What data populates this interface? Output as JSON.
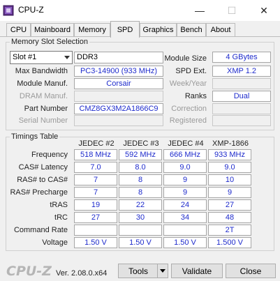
{
  "window": {
    "title": "CPU-Z",
    "minimize": "—",
    "maximize": "☐",
    "close": "✕"
  },
  "tabs": [
    {
      "label": "CPU"
    },
    {
      "label": "Mainboard"
    },
    {
      "label": "Memory"
    },
    {
      "label": "SPD"
    },
    {
      "label": "Graphics"
    },
    {
      "label": "Bench"
    },
    {
      "label": "About"
    }
  ],
  "active_tab": "SPD",
  "slot": {
    "group_title": "Memory Slot Selection",
    "selected": "Slot #1",
    "type": "DDR3",
    "module_size_label": "Module Size",
    "module_size": "4 GBytes",
    "max_bandwidth_label": "Max Bandwidth",
    "max_bandwidth": "PC3-14900 (933 MHz)",
    "spd_ext_label": "SPD Ext.",
    "spd_ext": "XMP 1.2",
    "module_manuf_label": "Module Manuf.",
    "module_manuf": "Corsair",
    "week_year_label": "Week/Year",
    "week_year": "",
    "dram_manuf_label": "DRAM Manuf.",
    "dram_manuf": "",
    "ranks_label": "Ranks",
    "ranks": "Dual",
    "part_number_label": "Part Number",
    "part_number": "CMZ8GX3M2A1866C9",
    "correction_label": "Correction",
    "correction": "",
    "serial_number_label": "Serial Number",
    "serial_number": "",
    "registered_label": "Registered",
    "registered": ""
  },
  "timings": {
    "group_title": "Timings Table",
    "columns": [
      "JEDEC #2",
      "JEDEC #3",
      "JEDEC #4",
      "XMP-1866"
    ],
    "rows": [
      {
        "label": "Frequency",
        "values": [
          "518 MHz",
          "592 MHz",
          "666 MHz",
          "933 MHz"
        ]
      },
      {
        "label": "CAS# Latency",
        "values": [
          "7.0",
          "8.0",
          "9.0",
          "9.0"
        ]
      },
      {
        "label": "RAS# to CAS#",
        "values": [
          "7",
          "8",
          "9",
          "10"
        ]
      },
      {
        "label": "RAS# Precharge",
        "values": [
          "7",
          "8",
          "9",
          "9"
        ]
      },
      {
        "label": "tRAS",
        "values": [
          "19",
          "22",
          "24",
          "27"
        ]
      },
      {
        "label": "tRC",
        "values": [
          "27",
          "30",
          "34",
          "48"
        ]
      },
      {
        "label": "Command Rate",
        "values": [
          "",
          "",
          "",
          "2T"
        ]
      },
      {
        "label": "Voltage",
        "values": [
          "1.50 V",
          "1.50 V",
          "1.50 V",
          "1.500 V"
        ]
      }
    ]
  },
  "footer": {
    "logo": "CPU-Z",
    "version": "Ver. 2.08.0.x64",
    "tools_label": "Tools",
    "validate_label": "Validate",
    "close_label": "Close"
  }
}
